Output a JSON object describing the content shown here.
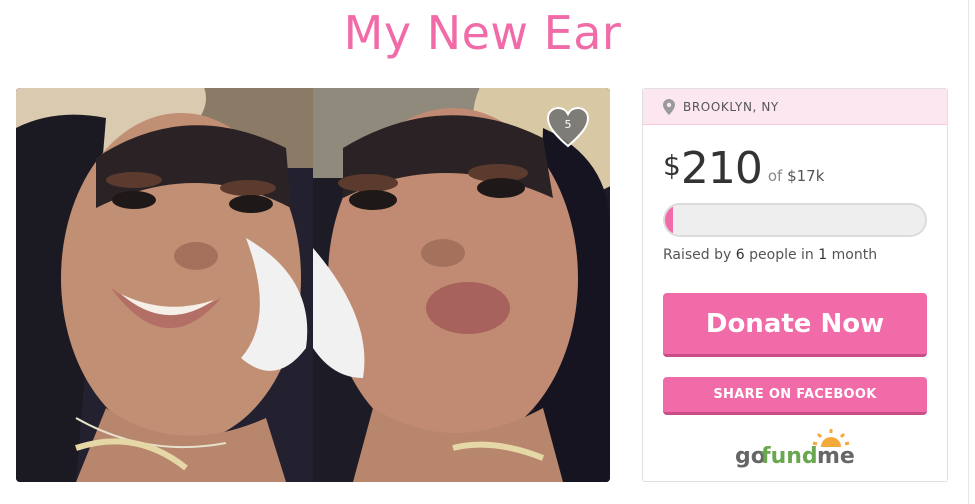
{
  "campaign": {
    "title": "My New Ear",
    "likes": "5"
  },
  "card": {
    "location": "BROOKLYN, NY",
    "currency_symbol": "$",
    "raised_amount": "210",
    "of_label": "of",
    "goal": "$17k",
    "progress_fraction": 0.012,
    "raised_by_prefix": "Raised by",
    "donor_count": "6",
    "raised_by_middle": "people in",
    "duration_value": "1",
    "duration_unit": "month",
    "donate_label": "Donate Now",
    "share_label": "SHARE ON FACEBOOK",
    "logo_text_go": "go",
    "logo_text_fund": "fund",
    "logo_text_me": "me"
  },
  "colors": {
    "brand_pink": "#f06ba8",
    "location_bar": "#fce6f0",
    "logo_green": "#6aa84f",
    "logo_gray": "#666666",
    "logo_sun": "#f4a93b"
  },
  "icons": [
    "location-pin-icon",
    "heart-icon",
    "gofundme-sun-icon"
  ]
}
